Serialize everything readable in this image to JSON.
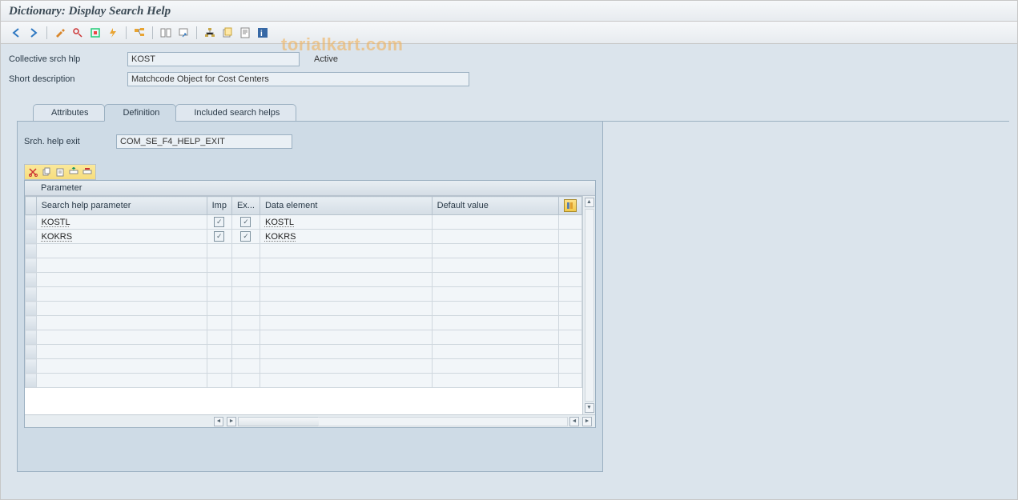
{
  "title": "Dictionary: Display Search Help",
  "watermark": "torialkart.com",
  "toolbar": {
    "icons": [
      "back-arrow-icon",
      "forward-arrow-icon",
      "__sep",
      "display-change-icon",
      "other-object-icon",
      "check-icon",
      "activate-icon",
      "__sep",
      "where-used-icon",
      "__sep",
      "object-list-icon",
      "navigation-icon",
      "__sep",
      "hierarchy-icon",
      "version-icon",
      "documentation-icon",
      "help-icon"
    ]
  },
  "form": {
    "collective_label": "Collective srch hlp",
    "collective_value": "KOST",
    "status": "Active",
    "short_desc_label": "Short description",
    "short_desc_value": "Matchcode Object for Cost Centers"
  },
  "tabs": {
    "items": [
      {
        "label": "Attributes"
      },
      {
        "label": "Definition"
      },
      {
        "label": "Included search helps"
      }
    ],
    "active": 1
  },
  "definition": {
    "exit_label": "Srch. help exit",
    "exit_value": "COM_SE_F4_HELP_EXIT"
  },
  "mini_toolbar": [
    "cut-icon",
    "copy-icon",
    "paste-icon",
    "insert-row-icon",
    "delete-row-icon"
  ],
  "grid": {
    "title": "Parameter",
    "columns": {
      "param": "Search help parameter",
      "imp": "Imp",
      "ex": "Ex...",
      "de": "Data element",
      "def": "Default value"
    },
    "rows": [
      {
        "param": "KOSTL",
        "imp": true,
        "ex": true,
        "de": "KOSTL",
        "def": ""
      },
      {
        "param": "KOKRS",
        "imp": true,
        "ex": true,
        "de": "KOKRS",
        "def": ""
      }
    ],
    "blank_rows": 10
  }
}
